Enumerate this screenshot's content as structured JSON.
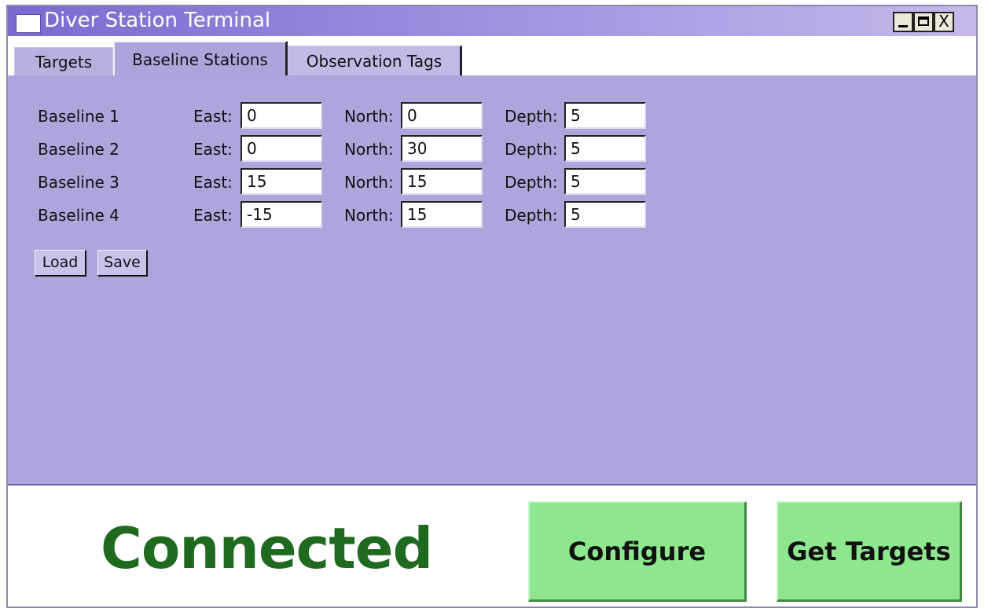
{
  "window": {
    "title": "Diver Station Terminal",
    "controls": {
      "minimize": "_",
      "maximize": "□",
      "close": "X"
    }
  },
  "tabs": [
    {
      "label": "Targets",
      "active": false
    },
    {
      "label": "Baseline Stations",
      "active": true
    },
    {
      "label": "Observation Tags",
      "active": false
    }
  ],
  "baseline": {
    "east_label": "East:",
    "north_label": "North:",
    "depth_label": "Depth:",
    "rows": [
      {
        "name": "Baseline 1",
        "east": "0",
        "north": "0",
        "depth": "5"
      },
      {
        "name": "Baseline 2",
        "east": "0",
        "north": "30",
        "depth": "5"
      },
      {
        "name": "Baseline 3",
        "east": "15",
        "north": "15",
        "depth": "5"
      },
      {
        "name": "Baseline 4",
        "east": "-15",
        "north": "15",
        "depth": "5"
      }
    ],
    "load_label": "Load",
    "save_label": "Save"
  },
  "footer": {
    "status": "Connected",
    "configure_label": "Configure",
    "get_targets_label": "Get Targets"
  },
  "colors": {
    "panel": "#aca6dd",
    "status_text": "#1f6a1f",
    "action_button": "#8ee68e"
  }
}
